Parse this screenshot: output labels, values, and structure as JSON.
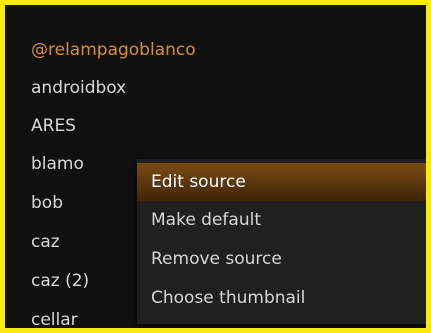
{
  "colors": {
    "border": "#f6ea12",
    "background": "#101010",
    "focused_text": "#d88f31",
    "menu_background": "#202020",
    "menu_highlight": "#6b400f"
  },
  "sources": [
    {
      "label": "@relampagoblanco",
      "focused": true
    },
    {
      "label": "androidbox",
      "focused": false
    },
    {
      "label": "ARES",
      "focused": false
    },
    {
      "label": "blamo",
      "focused": false
    },
    {
      "label": "bob",
      "focused": false
    },
    {
      "label": "caz",
      "focused": false
    },
    {
      "label": "caz (2)",
      "focused": false
    },
    {
      "label": "cellar",
      "focused": false
    }
  ],
  "context_menu": {
    "items": [
      {
        "label": "Edit source",
        "active": true
      },
      {
        "label": "Make default",
        "active": false
      },
      {
        "label": "Remove source",
        "active": false
      },
      {
        "label": "Choose thumbnail",
        "active": false
      }
    ]
  }
}
